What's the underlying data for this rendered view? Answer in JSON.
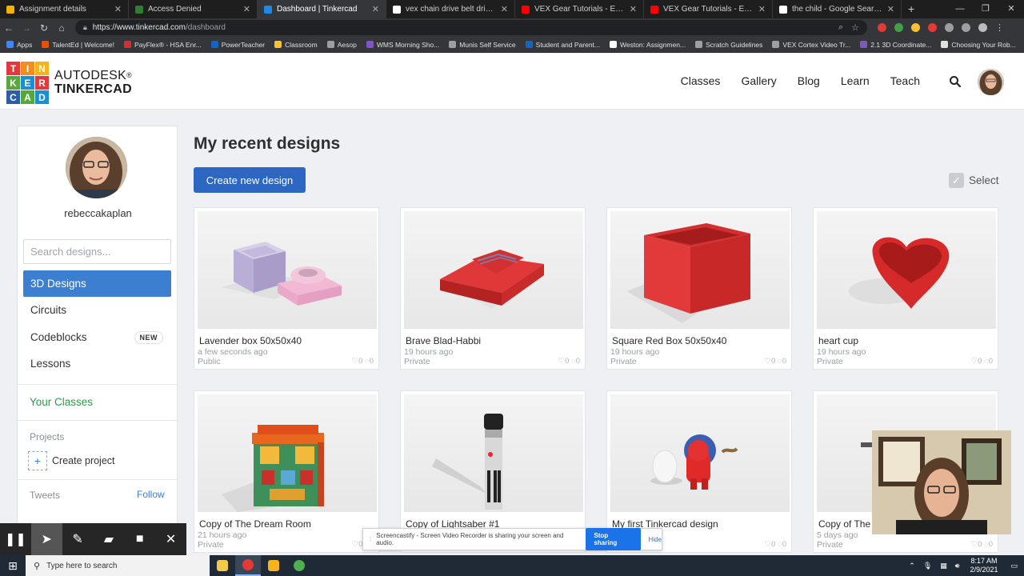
{
  "browser": {
    "tabs": [
      {
        "label": "Assignment details",
        "color": "#f4b400",
        "active": false
      },
      {
        "label": "Access Denied",
        "color": "#2e7d32",
        "active": false
      },
      {
        "label": "Dashboard | Tinkercad",
        "color": "#1e88e5",
        "active": true
      },
      {
        "label": "vex chain drive belt drive youtub",
        "color": "#ffffff",
        "active": false
      },
      {
        "label": "VEX Gear Tutorials - Examining",
        "color": "#ff0000",
        "active": false
      },
      {
        "label": "VEX Gear Tutorials - Examining",
        "color": "#ff0000",
        "active": false
      },
      {
        "label": "the child - Google Search",
        "color": "#ffffff",
        "active": false
      }
    ],
    "new_tab": "+",
    "url_host": "https://www.tinkercad.com",
    "url_path": "/dashboard",
    "bookmarks": [
      {
        "label": "Apps",
        "color": "#4285f4"
      },
      {
        "label": "TalentEd | Welcome!",
        "color": "#e65100"
      },
      {
        "label": "PayFlex® - HSA Enr...",
        "color": "#d32f2f"
      },
      {
        "label": "PowerTeacher",
        "color": "#1565c0"
      },
      {
        "label": "Classroom",
        "color": "#fbc02d"
      },
      {
        "label": "Aesop",
        "color": "#9e9e9e"
      },
      {
        "label": "WMS Morning Sho...",
        "color": "#7e57c2"
      },
      {
        "label": "Munis Self Service",
        "color": "#9e9e9e"
      },
      {
        "label": "Student and Parent...",
        "color": "#1565c0"
      },
      {
        "label": "Weston: Assignmen...",
        "color": "#ffffff"
      },
      {
        "label": "Scratch Guidelines",
        "color": "#9e9e9e"
      },
      {
        "label": "VEX Cortex Video Tr...",
        "color": "#9e9e9e"
      },
      {
        "label": "2.1 3D Coordinate...",
        "color": "#7e57c2"
      },
      {
        "label": "Choosing Your Rob...",
        "color": "#e0e0e0"
      }
    ]
  },
  "header": {
    "logo_letters": [
      "T",
      "I",
      "N",
      "K",
      "E",
      "R",
      "C",
      "A",
      "D"
    ],
    "logo_colors": [
      "#e3383d",
      "#f08f1f",
      "#f6b41b",
      "#5da53f",
      "#1d8fd1",
      "#e3383d",
      "#2c5ea8",
      "#56a83c",
      "#1d8fd1"
    ],
    "brand_line1": "AUTODESK",
    "brand_line1_mark": "®",
    "brand_line2": "TINKERCAD",
    "nav": [
      "Classes",
      "Gallery",
      "Blog",
      "Learn",
      "Teach"
    ]
  },
  "sidebar": {
    "username": "rebeccakaplan",
    "search_placeholder": "Search designs...",
    "items": [
      {
        "label": "3D Designs",
        "active": true
      },
      {
        "label": "Circuits",
        "active": false
      },
      {
        "label": "Codeblocks",
        "active": false,
        "badge": "NEW"
      },
      {
        "label": "Lessons",
        "active": false
      }
    ],
    "your_classes": "Your Classes",
    "projects_label": "Projects",
    "create_project": "Create project",
    "tweets_label": "Tweets",
    "follow": "Follow"
  },
  "main": {
    "title": "My recent designs",
    "create_button": "Create new design",
    "select_label": "Select",
    "designs": [
      {
        "title": "Lavender box 50x50x40",
        "time": "a few seconds ago",
        "visibility": "Public",
        "likes": "0",
        "comments": "0"
      },
      {
        "title": "Brave Blad-Habbi",
        "time": "19 hours ago",
        "visibility": "Private",
        "likes": "0",
        "comments": "0"
      },
      {
        "title": "Square Red Box 50x50x40",
        "time": "19 hours ago",
        "visibility": "Private",
        "likes": "0",
        "comments": "0"
      },
      {
        "title": "heart cup",
        "time": "19 hours ago",
        "visibility": "Private",
        "likes": "0",
        "comments": "0"
      },
      {
        "title": "Copy of The Dream Room",
        "time": "21 hours ago",
        "visibility": "Private",
        "likes": "0",
        "comments": "0"
      },
      {
        "title": "Copy of Lightsaber #1",
        "time": "",
        "visibility": "",
        "likes": "",
        "comments": ""
      },
      {
        "title": "My first Tinkercad design",
        "time": "",
        "visibility": "",
        "likes": "0",
        "comments": "0"
      },
      {
        "title": "Copy of The",
        "time": "5 days ago",
        "visibility": "Private",
        "likes": "0",
        "comments": "0"
      }
    ]
  },
  "screencastify": {
    "message": "Screencastify - Screen Video Recorder is sharing your screen and audio.",
    "stop_label": "Stop sharing",
    "hide_label": "Hide"
  },
  "taskbar": {
    "search_placeholder": "Type here to search",
    "time": "8:17 AM",
    "date": "2/9/2021"
  },
  "colors": {
    "accent_blue": "#2d67c2",
    "active_nav": "#3c7ed0",
    "classes_green": "#2f9a4a"
  }
}
